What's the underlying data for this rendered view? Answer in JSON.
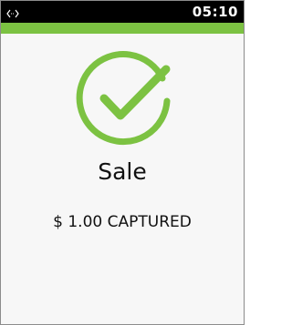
{
  "status_bar": {
    "time": "05:10",
    "connection_icon": "bidirectional-arrows-icon"
  },
  "colors": {
    "accent": "#7cc242",
    "status_bar_bg": "#000000"
  },
  "result": {
    "icon": "success-check-icon",
    "title": "Sale",
    "amount_text": "$ 1.00 CAPTURED"
  }
}
